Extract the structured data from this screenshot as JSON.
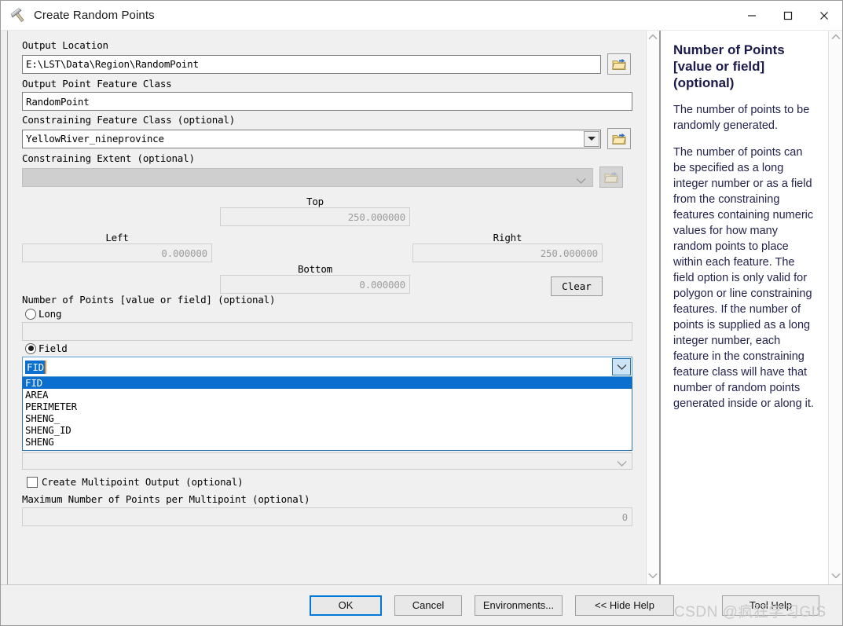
{
  "window": {
    "title": "Create Random Points",
    "icon": "hammer-icon",
    "controls": {
      "minimize": "—",
      "maximize": "☐",
      "close": "✕"
    }
  },
  "form": {
    "output_location": {
      "label": "Output Location",
      "value": "E:\\LST\\Data\\Region\\RandomPoint",
      "browse_icon": "open-folder-icon"
    },
    "output_point_feature_class": {
      "label": "Output Point Feature Class",
      "value": "RandomPoint"
    },
    "constraining_feature_class": {
      "label": "Constraining Feature Class (optional)",
      "value": "YellowRiver_nineprovince",
      "browse_icon": "open-folder-icon"
    },
    "constraining_extent": {
      "label": "Constraining Extent (optional)",
      "value": "",
      "browse_icon": "open-folder-icon-disabled"
    },
    "extent": {
      "top_label": "Top",
      "top_value": "250.000000",
      "left_label": "Left",
      "left_value": "0.000000",
      "right_label": "Right",
      "right_value": "250.000000",
      "bottom_label": "Bottom",
      "bottom_value": "0.000000",
      "clear_label": "Clear"
    },
    "number_of_points": {
      "label": "Number of Points [value or field] (optional)",
      "long_label": "Long",
      "long_selected": false,
      "long_value": "",
      "field_label": "Field",
      "field_selected": true,
      "field_value": "FID",
      "dropdown_open": true,
      "dropdown_items": [
        "FID",
        "AREA",
        "PERIMETER",
        "SHENG_",
        "SHENG_ID",
        "SHENG"
      ],
      "dropdown_selected_index": 0,
      "secondary_value": ""
    },
    "create_multipoint_output": {
      "label": "Create Multipoint Output (optional)",
      "checked": false
    },
    "max_points_per_multipoint": {
      "label": "Maximum Number of Points per Multipoint (optional)",
      "value": "0"
    }
  },
  "help": {
    "title": "Number of Points [value or field] (optional)",
    "paragraphs": [
      "The number of points to be randomly generated.",
      "The number of points can be specified as a long integer number or as a field from the constraining features containing numeric values for how many random points to place within each feature. The field option is only valid for polygon or line constraining features. If the number of points is supplied as a long integer number, each feature in the constraining feature class will have that number of random points generated inside or along it."
    ]
  },
  "footer": {
    "ok": "OK",
    "cancel": "Cancel",
    "environments": "Environments...",
    "hide_help": "<< Hide Help",
    "tool_help": "Tool Help"
  },
  "watermark": "CSDN @疯狂学习GIS",
  "colors": {
    "accent": "#0078d7",
    "selection": "#0b6fd0",
    "dialog_bg": "#f0f0f0",
    "help_text": "#23234e"
  }
}
